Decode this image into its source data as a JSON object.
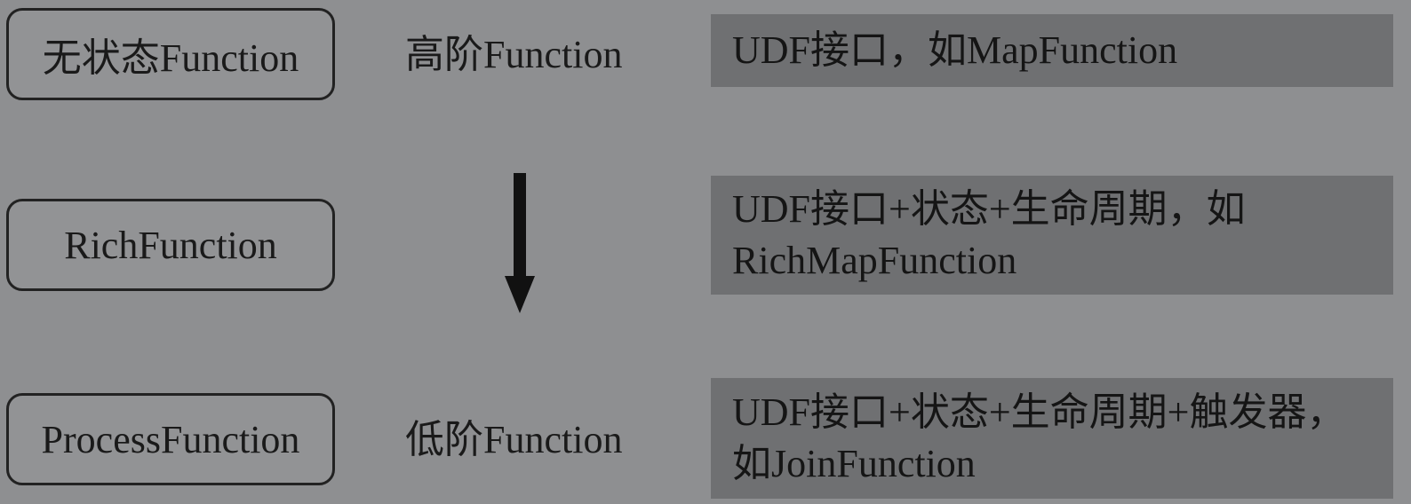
{
  "levels": [
    {
      "name": "无状态Function",
      "description": [
        "UDF接口，如MapFunction"
      ]
    },
    {
      "name": "RichFunction",
      "description": [
        "UDF接口+状态+生命周期，如",
        "RichMapFunction"
      ]
    },
    {
      "name": "ProcessFunction",
      "description": [
        "UDF接口+状态+生命周期+触发器，",
        "如JoinFunction"
      ]
    }
  ],
  "order": {
    "high_label": "高阶Function",
    "low_label": "低阶Function"
  },
  "colors": {
    "background": "#8e8f91",
    "box_border": "#222222",
    "panel": "#6f7072",
    "arrow": "#111111"
  }
}
